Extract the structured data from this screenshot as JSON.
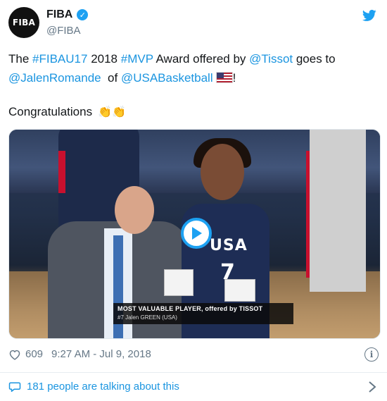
{
  "account": {
    "avatar_text": "FIBA",
    "display_name": "FIBA",
    "handle": "@FIBA",
    "verified_mark": "✓"
  },
  "tweet": {
    "text_prefix": "The ",
    "tag1": "#FIBAU17",
    "text2": " 2018 ",
    "tag2": "#MVP",
    "text3": " Award offered by ",
    "mention1": "@Tissot",
    "text4": " goes to",
    "mention2": "@JalenRomande",
    "text5": "  of ",
    "mention3": "@USABasketball",
    "text6": "!",
    "congrats": "Congratulations",
    "clap_emoji": "👏👏"
  },
  "media": {
    "jersey_text": "USA",
    "jersey_number": "7",
    "caption_line1": "MOST VALUABLE PLAYER, offered by TISSOT",
    "caption_line2": "#7 Jalen GREEN (USA)"
  },
  "footer": {
    "likes": "609",
    "timestamp": "9:27 AM - Jul 9, 2018",
    "talk_text": "181 people are talking about this"
  },
  "colors": {
    "link": "#1b95e0",
    "twitter_blue": "#1da1f2",
    "muted": "#657786"
  },
  "icons": [
    "twitter-bird-icon",
    "verified-icon",
    "heart-icon",
    "info-icon",
    "comment-icon",
    "chevron-right-icon",
    "play-icon"
  ]
}
